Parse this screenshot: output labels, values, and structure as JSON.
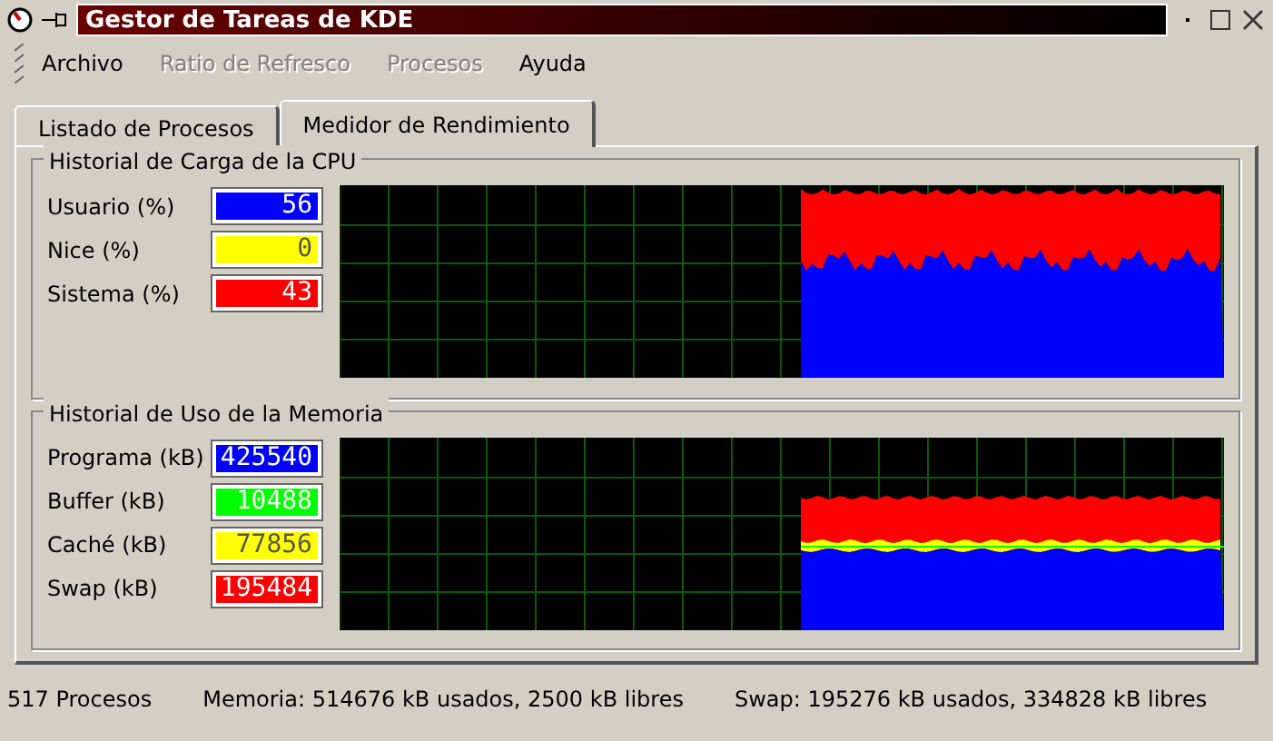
{
  "window": {
    "title": "Gestor de Tareas de KDE"
  },
  "menu": [
    {
      "label": "Archivo",
      "disabled": false
    },
    {
      "label": "Ratio de Refresco",
      "disabled": true
    },
    {
      "label": "Procesos",
      "disabled": true
    },
    {
      "label": "Ayuda",
      "disabled": false
    }
  ],
  "tabs": [
    {
      "label": "Listado de Procesos",
      "selected": false
    },
    {
      "label": "Medidor de Rendimiento",
      "selected": true
    }
  ],
  "cpu": {
    "title": "Historial de Carga de la CPU",
    "meters": [
      {
        "label": "Usuario (%)",
        "value": "56",
        "color": "#0000ff"
      },
      {
        "label": "Nice (%)",
        "value": "0",
        "color": "#ffff00"
      },
      {
        "label": "Sistema (%)",
        "value": "43",
        "color": "#ff0000"
      }
    ]
  },
  "memory": {
    "title": "Historial de Uso de la Memoria",
    "meters": [
      {
        "label": "Programa (kB)",
        "value": "425540",
        "color": "#0000ff"
      },
      {
        "label": "Buffer (kB)",
        "value": "10488",
        "color": "#00ff00"
      },
      {
        "label": "Caché (kB)",
        "value": "77856",
        "color": "#ffff00"
      },
      {
        "label": "Swap (kB)",
        "value": "195484",
        "color": "#ff0000"
      }
    ]
  },
  "status_bar": [
    "517 Procesos",
    "Memoria: 514676 kB usados, 2500 kB libres",
    "Swap: 195276 kB usados, 334828 kB libres"
  ]
}
